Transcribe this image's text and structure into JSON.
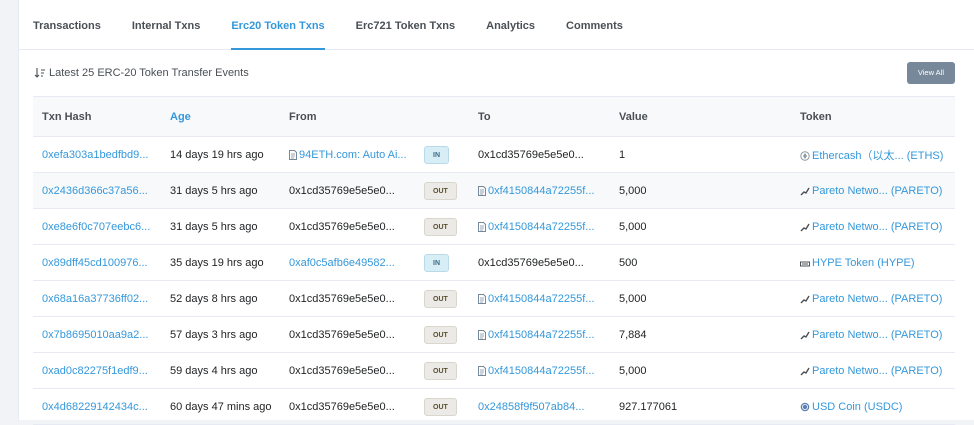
{
  "tabs": [
    {
      "label": "Transactions"
    },
    {
      "label": "Internal Txns"
    },
    {
      "label": "Erc20 Token Txns"
    },
    {
      "label": "Erc721 Token Txns"
    },
    {
      "label": "Analytics"
    },
    {
      "label": "Comments"
    }
  ],
  "active_tab": "Erc20 Token Txns",
  "subhead": {
    "summary": "Latest 25 ERC-20 Token Transfer Events",
    "view_all_label": "View All"
  },
  "table": {
    "headers": [
      "Txn Hash",
      "Age",
      "From",
      "",
      "To",
      "Value",
      "Token"
    ],
    "rows": [
      {
        "hash": "0xefa303a1bedfbd9...",
        "age": "14 days 19 hrs ago",
        "from": "94ETH.com: Auto Ai...",
        "dir": "IN",
        "to": "0x1cd35769e5e5e0...",
        "value": "1",
        "token": "Ethercash（以太... (ETHS)"
      },
      {
        "hash": "0x2436d366c37a56...",
        "age": "31 days 5 hrs ago",
        "from": "0x1cd35769e5e5e0...",
        "dir": "OUT",
        "to": "0xf4150844a72255f...",
        "value": "5,000",
        "token": "Pareto Netwo... (PARETO)"
      },
      {
        "hash": "0xe8e6f0c707eebc6...",
        "age": "31 days 5 hrs ago",
        "from": "0x1cd35769e5e5e0...",
        "dir": "OUT",
        "to": "0xf4150844a72255f...",
        "value": "5,000",
        "token": "Pareto Netwo... (PARETO)"
      },
      {
        "hash": "0x89dff45cd100976...",
        "age": "35 days 19 hrs ago",
        "from": "0xaf0c5afb6e49582...",
        "dir": "IN",
        "to": "0x1cd35769e5e5e0...",
        "value": "500",
        "token": "HYPE Token (HYPE)"
      },
      {
        "hash": "0x68a16a37736ff02...",
        "age": "52 days 8 hrs ago",
        "from": "0x1cd35769e5e5e0...",
        "dir": "OUT",
        "to": "0xf4150844a72255f...",
        "value": "5,000",
        "token": "Pareto Netwo... (PARETO)"
      },
      {
        "hash": "0x7b8695010aa9a2...",
        "age": "57 days 3 hrs ago",
        "from": "0x1cd35769e5e5e0...",
        "dir": "OUT",
        "to": "0xf4150844a72255f...",
        "value": "7,884",
        "token": "Pareto Netwo... (PARETO)"
      },
      {
        "hash": "0xad0c82275f1edf9...",
        "age": "59 days 4 hrs ago",
        "from": "0x1cd35769e5e5e0...",
        "dir": "OUT",
        "to": "0xf4150844a72255f...",
        "value": "5,000",
        "token": "Pareto Netwo... (PARETO)"
      },
      {
        "hash": "0x4d68229142434c...",
        "age": "60 days 47 mins ago",
        "from": "0x1cd35769e5e5e0...",
        "dir": "OUT",
        "to": "0x24858f9f507ab84...",
        "value": "927.177061",
        "token": "USD Coin (USDC)"
      }
    ]
  },
  "icons": {
    "sort": "sort-desc-icon",
    "contract": "contract-file-icon",
    "eths": "ethercash-token-icon",
    "pareto": "pareto-token-icon",
    "hype": "hype-token-icon",
    "usdc": "usdc-token-icon"
  },
  "colors": {
    "link": "#3498db",
    "in_badge_bg": "#d8eef6",
    "out_badge_bg": "#ebeae6",
    "view_all_bg": "#77889a"
  }
}
